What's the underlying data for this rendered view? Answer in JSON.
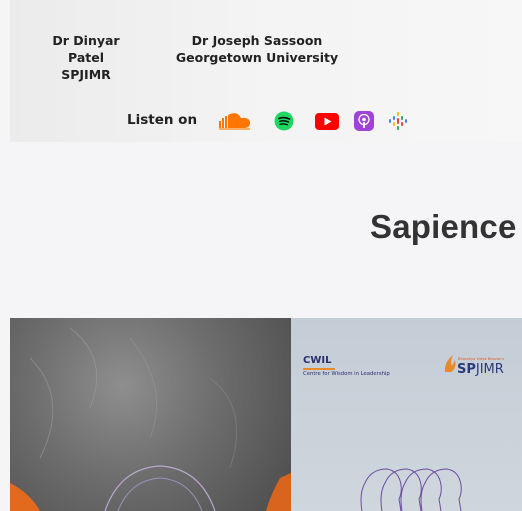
{
  "banner": {
    "speaker1": {
      "name": "Dr Dinyar Patel",
      "affiliation": "SPJIMR"
    },
    "speaker2": {
      "name": "Dr Joseph Sassoon",
      "affiliation": "Georgetown University"
    },
    "listen_label": "Listen on",
    "platforms": [
      {
        "icon": "soundcloud-icon",
        "color": "#ff7700"
      },
      {
        "icon": "spotify-icon",
        "color": "#1ed760"
      },
      {
        "icon": "youtube-icon",
        "color": "#ff0000"
      },
      {
        "icon": "apple-podcasts-icon",
        "color": "#a044d8"
      },
      {
        "icon": "google-podcasts-icon",
        "color": "#4285f4"
      }
    ]
  },
  "heading": {
    "text": "Sapience"
  },
  "cover": {
    "cwil_title": "CWIL",
    "cwil_subtitle": "Centre for Wisdom in Leadership",
    "spjimr_tagline": "Bharatiya Vidya Bhavan's",
    "spjimr_sp": "SP",
    "spjimr_jimr": "JIMR",
    "accent_orange": "#e98a2a",
    "navy": "#2a2f6e"
  }
}
